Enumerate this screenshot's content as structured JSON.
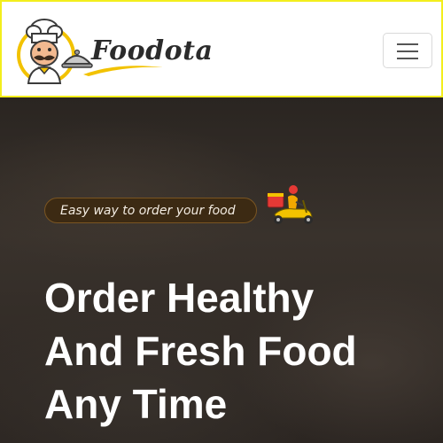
{
  "header": {
    "brand_name": "Foodota",
    "logo_icon": "chef-mascot-icon",
    "menu_icon": "hamburger-menu-icon",
    "colors": {
      "border": "#f3ee1c",
      "swoosh": "#f2c200"
    }
  },
  "hero": {
    "tagline": "Easy way to order your food",
    "tagline_icon": "delivery-scooter-icon",
    "title_lines": [
      "Order Healthy",
      "And Fresh Food",
      "Any Time"
    ]
  }
}
